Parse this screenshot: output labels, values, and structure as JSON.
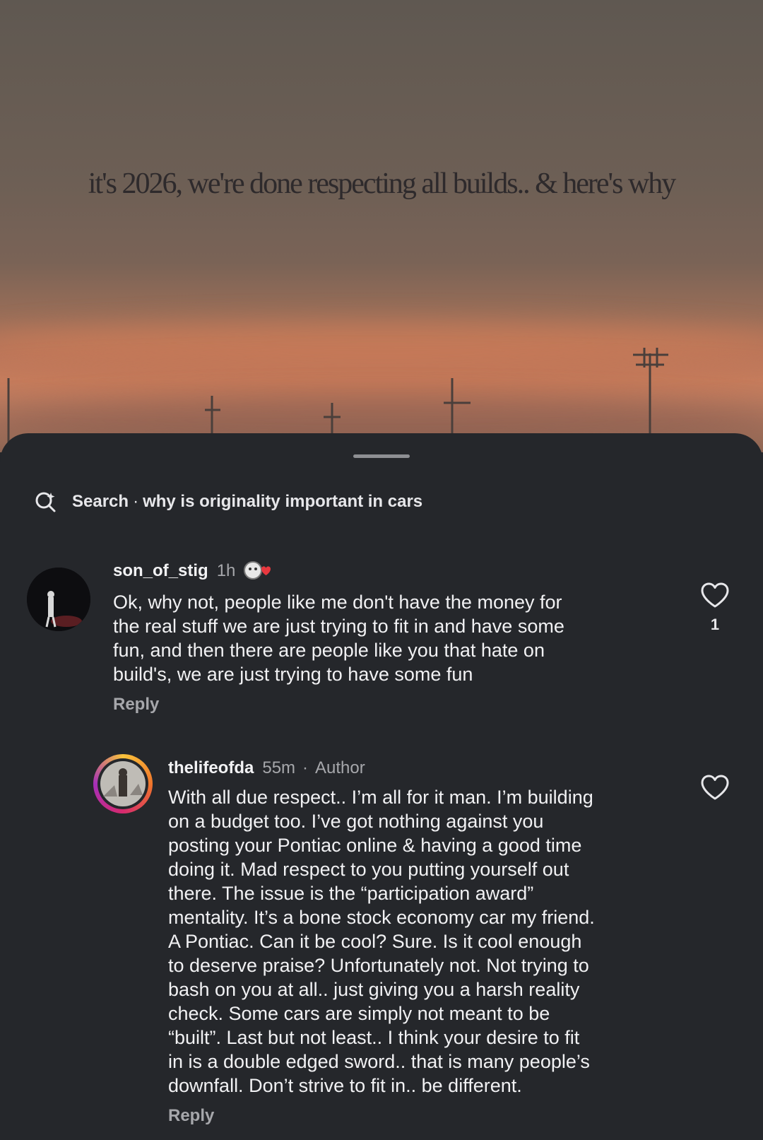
{
  "video": {
    "overlay_text": "it's 2026, we're done respecting all builds.. & here's why"
  },
  "sheet": {
    "search": {
      "label": "Search",
      "separator": "·",
      "query": "why is originality important in cars"
    },
    "comments": [
      {
        "username": "son_of_stig",
        "time": "1h",
        "body": "Ok, why not, people like me don't have the money for\nthe real stuff we are just trying to fit in and have some\nfun, and then there are people like you that hate on\nbuild's, we are just trying to have some fun",
        "reply_label": "Reply",
        "like_count": "1",
        "sticker_icon": "heart-sticker-icon"
      },
      {
        "username": "thelifeofda",
        "time": "55m",
        "separator": "·",
        "author_tag": "Author",
        "body": "With all due respect.. I’m all for it man. I’m building\non a budget too. I’ve got nothing against you\nposting your Pontiac online & having a good time\ndoing it. Mad respect to you putting yourself out\nthere. The issue is the “participation award”\nmentality. It’s a bone stock economy car my friend.\nA Pontiac. Can it be cool? Sure. Is it cool enough\nto deserve praise? Unfortunately not. Not trying to\nbash on you at all.. just giving you a harsh reality\ncheck. Some cars are simply not meant to be\n“built”. Last but not least.. I think your desire to fit\nin is a double edged sword.. that is many people’s\ndownfall. Don’t strive to fit in.. be different.",
        "reply_label": "Reply"
      }
    ]
  },
  "colors": {
    "sheet_bg": "#25272b",
    "text_primary": "#f1f1f3",
    "text_secondary": "#a6a7ab",
    "sky_top": "#5f5851",
    "sky_glow": "#c77f5f"
  }
}
